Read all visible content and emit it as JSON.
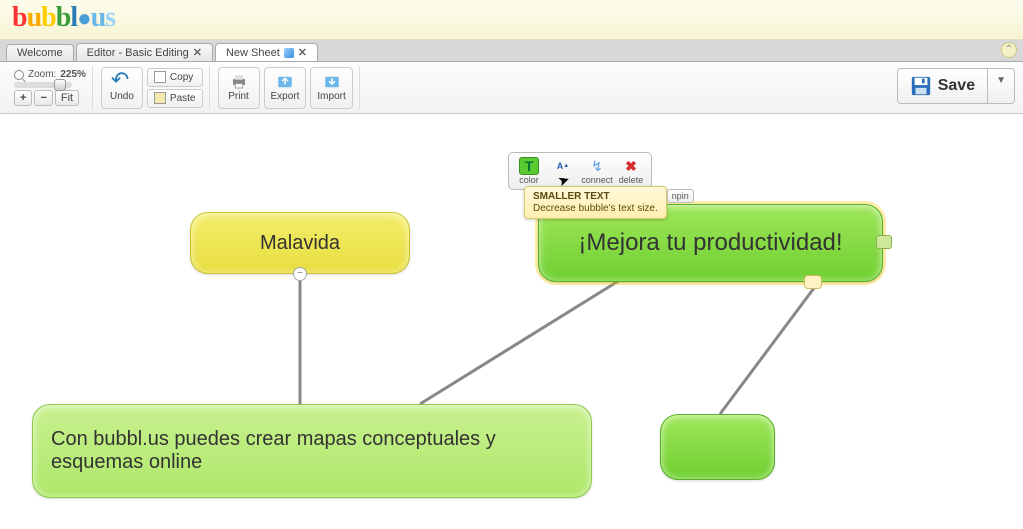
{
  "app": {
    "name": "bubbl.us"
  },
  "tabs": [
    {
      "label": "Welcome",
      "closable": false
    },
    {
      "label": "Editor - Basic Editing",
      "closable": true
    },
    {
      "label": "New Sheet",
      "closable": true,
      "active": true
    }
  ],
  "toolbar": {
    "zoom_label": "Zoom:",
    "zoom_value": "225%",
    "zoom_plus": "+",
    "zoom_minus": "−",
    "fit": "Fit",
    "undo": "Undo",
    "copy": "Copy",
    "paste": "Paste",
    "print": "Print",
    "export": "Export",
    "import": "Import",
    "save": "Save"
  },
  "bubble_toolbar": {
    "color": "color",
    "size_short": "s",
    "connect": "connect",
    "delete": "delete",
    "unpin": "npin"
  },
  "tooltip": {
    "title": "SMALLER TEXT",
    "desc": "Decrease bubble's text size."
  },
  "bubbles": {
    "malavida": "Malavida",
    "mejora": "¡Mejora tu productividad!",
    "long": "Con bubbl.us puedes crear mapas conceptuales y esquemas online",
    "small": ""
  },
  "colors": {
    "yellow": "#e8de40",
    "green": "#6fd030",
    "lightgreen": "#aee86a"
  }
}
